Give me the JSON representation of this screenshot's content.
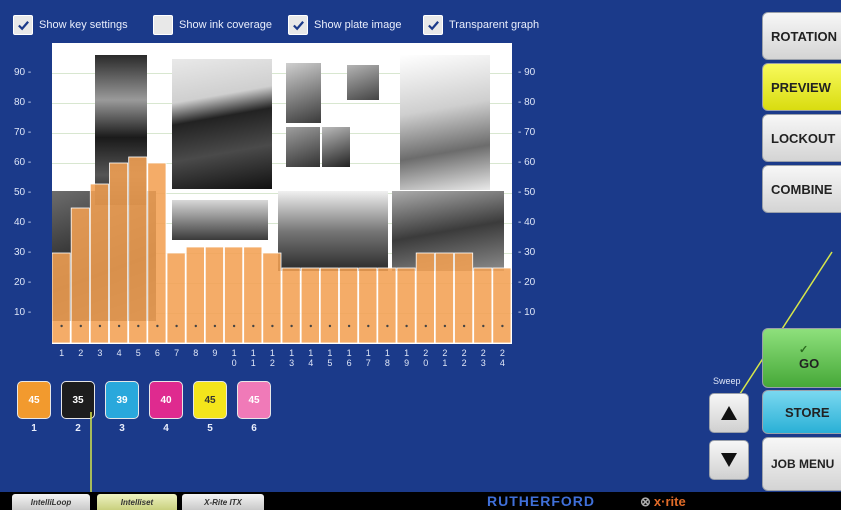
{
  "toolbar": {
    "show_key_settings": {
      "label": "Show key settings",
      "checked": true
    },
    "show_ink_coverage": {
      "label": "Show ink coverage",
      "checked": false
    },
    "show_plate_image": {
      "label": "Show plate image",
      "checked": true
    },
    "transparent_graph": {
      "label": "Transparent graph",
      "checked": true
    }
  },
  "chart_data": {
    "type": "bar",
    "ylim": [
      0,
      100
    ],
    "yticks": [
      "90 -",
      "80 -",
      "70 -",
      "60 -",
      "50 -",
      "40 -",
      "30 -",
      "20 -",
      "10 -"
    ],
    "yticks_right": [
      "- 90",
      "- 80",
      "- 70",
      "- 60",
      "- 50",
      "- 40",
      "- 30",
      "- 20",
      "- 10"
    ],
    "ytick_values": [
      90,
      80,
      70,
      60,
      50,
      40,
      30,
      20,
      10
    ],
    "categories": [
      "1",
      "2",
      "3",
      "4",
      "5",
      "6",
      "7",
      "8",
      "9",
      "10",
      "11",
      "12",
      "13",
      "14",
      "15",
      "16",
      "17",
      "18",
      "19",
      "20",
      "21",
      "22",
      "23",
      "24"
    ],
    "category_labels": [
      [
        "1"
      ],
      [
        "2"
      ],
      [
        "3"
      ],
      [
        "4"
      ],
      [
        "5"
      ],
      [
        "6"
      ],
      [
        "7"
      ],
      [
        "8"
      ],
      [
        "9"
      ],
      [
        "1",
        "0"
      ],
      [
        "1",
        "1"
      ],
      [
        "1",
        "2"
      ],
      [
        "1",
        "3"
      ],
      [
        "1",
        "4"
      ],
      [
        "1",
        "5"
      ],
      [
        "1",
        "6"
      ],
      [
        "1",
        "7"
      ],
      [
        "1",
        "8"
      ],
      [
        "1",
        "9"
      ],
      [
        "2",
        "0"
      ],
      [
        "2",
        "1"
      ],
      [
        "2",
        "2"
      ],
      [
        "2",
        "3"
      ],
      [
        "2",
        "4"
      ]
    ],
    "values": [
      30,
      45,
      53,
      60,
      62,
      60,
      30,
      32,
      32,
      32,
      32,
      30,
      25,
      25,
      25,
      25,
      25,
      25,
      25,
      30,
      30,
      30,
      25,
      25
    ]
  },
  "inks": [
    {
      "value": "45",
      "number": "1",
      "color": "#f29a2e"
    },
    {
      "value": "35",
      "number": "2",
      "color": "#1d1d1d"
    },
    {
      "value": "39",
      "number": "3",
      "color": "#29a8dc"
    },
    {
      "value": "40",
      "number": "4",
      "color": "#df2a8f"
    },
    {
      "value": "45",
      "number": "5",
      "color": "#f4e51b"
    },
    {
      "value": "45",
      "number": "6",
      "color": "#f07ab8"
    }
  ],
  "side_buttons": {
    "rotation": "ROTATION",
    "preview": "PREVIEW",
    "lockout": "LOCKOUT",
    "combine": "COMBINE",
    "go": "GO",
    "go_check": "✓",
    "store": "STORE",
    "job_menu": "JOB MENU"
  },
  "sweep": {
    "label": "Sweep"
  },
  "bottom_tabs": {
    "intelliloop": "IntelliLoop",
    "intelliset": "Intelliset",
    "xrite_itx": "X-Rite ITX"
  },
  "brand": {
    "rutherford": "RUTHERFORD",
    "xrite": "x·rite"
  },
  "colors": {
    "accent_yellow": "#eef026",
    "go_green": "#5cbf4a",
    "store_cyan": "#3fc1e3",
    "background": "#1b3a8a",
    "bar_orange": "#f2a153",
    "annotation_line": "#d6e64a"
  }
}
